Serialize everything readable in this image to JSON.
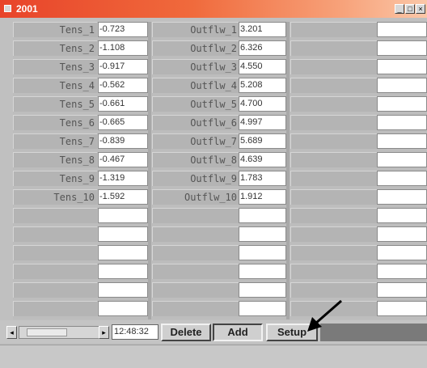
{
  "window": {
    "title": "2001"
  },
  "title_buttons": [
    "minimize",
    "maximize",
    "close"
  ],
  "rows": [
    {
      "tens_label": "Tens_1",
      "tens_value": "-0.723",
      "outflw_label": "Outflw_1",
      "outflw_value": "3.201"
    },
    {
      "tens_label": "Tens_2",
      "tens_value": "-1.108",
      "outflw_label": "Outflw_2",
      "outflw_value": "6.326"
    },
    {
      "tens_label": "Tens_3",
      "tens_value": "-0.917",
      "outflw_label": "Outflw_3",
      "outflw_value": "4.550"
    },
    {
      "tens_label": "Tens_4",
      "tens_value": "-0.562",
      "outflw_label": "Outflw_4",
      "outflw_value": "5.208"
    },
    {
      "tens_label": "Tens_5",
      "tens_value": "-0.661",
      "outflw_label": "Outflw_5",
      "outflw_value": "4.700"
    },
    {
      "tens_label": "Tens_6",
      "tens_value": "-0.665",
      "outflw_label": "Outflw_6",
      "outflw_value": "4.997"
    },
    {
      "tens_label": "Tens_7",
      "tens_value": "-0.839",
      "outflw_label": "Outflw_7",
      "outflw_value": "5.689"
    },
    {
      "tens_label": "Tens_8",
      "tens_value": "-0.467",
      "outflw_label": "Outflw_8",
      "outflw_value": "4.639"
    },
    {
      "tens_label": "Tens_9",
      "tens_value": "-1.319",
      "outflw_label": "Outflw_9",
      "outflw_value": "1.783"
    },
    {
      "tens_label": "Tens_10",
      "tens_value": "-1.592",
      "outflw_label": "Outflw_10",
      "outflw_value": "1.912"
    }
  ],
  "toolbar": {
    "time": "12:48:32",
    "delete_label": "Delete",
    "add_label": "Add",
    "setup_label": "Setup"
  },
  "colors": {
    "titlebar_start": "#e8442a",
    "titlebar_end": "#fbc7a8",
    "window_bg": "#c0c0c0"
  }
}
